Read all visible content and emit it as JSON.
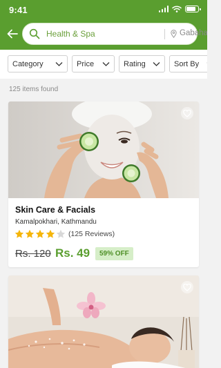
{
  "status_bar": {
    "time": "9:41",
    "battery_level": 0.85
  },
  "search": {
    "query": "Health & Spa",
    "placeholder": "Search",
    "location": "Gabahal"
  },
  "filters": [
    {
      "label": "Category"
    },
    {
      "label": "Price"
    },
    {
      "label": "Rating"
    },
    {
      "label": "Sort By"
    }
  ],
  "results": {
    "count_text": "125 items found"
  },
  "listings": [
    {
      "title": "Skin Care & Facials",
      "location": "Kamalpokhari, Kathmandu",
      "rating": 4,
      "rating_max": 5,
      "reviews": "(125 Reviews)",
      "old_price": "Rs. 120",
      "new_price": "Rs. 49",
      "discount": "59% OFF"
    },
    {
      "title": "",
      "location": ""
    }
  ],
  "colors": {
    "brand_green": "#5a9e2f",
    "price_green": "#5a9e2f",
    "discount_bg": "#d6eec8",
    "star_filled": "#f5b50a",
    "star_empty": "#d8d8d8"
  }
}
